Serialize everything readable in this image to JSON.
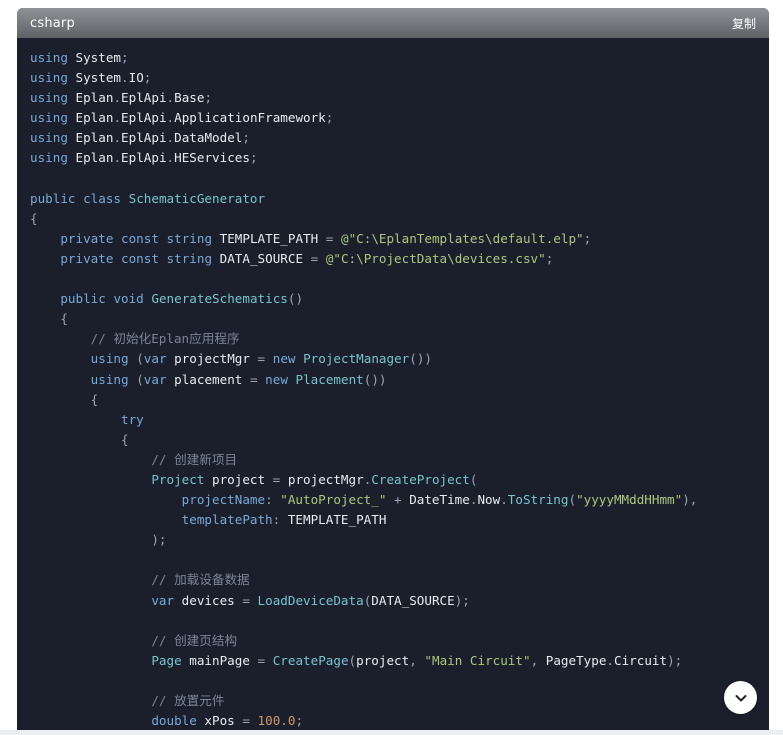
{
  "code_block": {
    "language": "csharp",
    "copy_label": "复制",
    "lines": [
      [
        [
          "kw",
          "using"
        ],
        [
          "ws",
          " "
        ],
        [
          "id",
          "System"
        ],
        [
          "pn",
          ";"
        ]
      ],
      [
        [
          "kw",
          "using"
        ],
        [
          "ws",
          " "
        ],
        [
          "id",
          "System"
        ],
        [
          "pn",
          "."
        ],
        [
          "id",
          "IO"
        ],
        [
          "pn",
          ";"
        ]
      ],
      [
        [
          "kw",
          "using"
        ],
        [
          "ws",
          " "
        ],
        [
          "id",
          "Eplan"
        ],
        [
          "pn",
          "."
        ],
        [
          "id",
          "EplApi"
        ],
        [
          "pn",
          "."
        ],
        [
          "id",
          "Base"
        ],
        [
          "pn",
          ";"
        ]
      ],
      [
        [
          "kw",
          "using"
        ],
        [
          "ws",
          " "
        ],
        [
          "id",
          "Eplan"
        ],
        [
          "pn",
          "."
        ],
        [
          "id",
          "EplApi"
        ],
        [
          "pn",
          "."
        ],
        [
          "id",
          "ApplicationFramework"
        ],
        [
          "pn",
          ";"
        ]
      ],
      [
        [
          "kw",
          "using"
        ],
        [
          "ws",
          " "
        ],
        [
          "id",
          "Eplan"
        ],
        [
          "pn",
          "."
        ],
        [
          "id",
          "EplApi"
        ],
        [
          "pn",
          "."
        ],
        [
          "id",
          "DataModel"
        ],
        [
          "pn",
          ";"
        ]
      ],
      [
        [
          "kw",
          "using"
        ],
        [
          "ws",
          " "
        ],
        [
          "id",
          "Eplan"
        ],
        [
          "pn",
          "."
        ],
        [
          "id",
          "EplApi"
        ],
        [
          "pn",
          "."
        ],
        [
          "id",
          "HEServices"
        ],
        [
          "pn",
          ";"
        ]
      ],
      [],
      [
        [
          "kw",
          "public"
        ],
        [
          "ws",
          " "
        ],
        [
          "kw",
          "class"
        ],
        [
          "ws",
          " "
        ],
        [
          "type",
          "SchematicGenerator"
        ]
      ],
      [
        [
          "pn",
          "{"
        ]
      ],
      [
        [
          "ws",
          "    "
        ],
        [
          "kw",
          "private"
        ],
        [
          "ws",
          " "
        ],
        [
          "kw",
          "const"
        ],
        [
          "ws",
          " "
        ],
        [
          "kw",
          "string"
        ],
        [
          "ws",
          " "
        ],
        [
          "id",
          "TEMPLATE_PATH"
        ],
        [
          "ws",
          " "
        ],
        [
          "pn",
          "="
        ],
        [
          "ws",
          " "
        ],
        [
          "str",
          "@\"C:\\EplanTemplates\\default.elp\""
        ],
        [
          "pn",
          ";"
        ]
      ],
      [
        [
          "ws",
          "    "
        ],
        [
          "kw",
          "private"
        ],
        [
          "ws",
          " "
        ],
        [
          "kw",
          "const"
        ],
        [
          "ws",
          " "
        ],
        [
          "kw",
          "string"
        ],
        [
          "ws",
          " "
        ],
        [
          "id",
          "DATA_SOURCE"
        ],
        [
          "ws",
          " "
        ],
        [
          "pn",
          "="
        ],
        [
          "ws",
          " "
        ],
        [
          "str",
          "@\"C:\\ProjectData\\devices.csv\""
        ],
        [
          "pn",
          ";"
        ]
      ],
      [],
      [
        [
          "ws",
          "    "
        ],
        [
          "kw",
          "public"
        ],
        [
          "ws",
          " "
        ],
        [
          "kw",
          "void"
        ],
        [
          "ws",
          " "
        ],
        [
          "fn",
          "GenerateSchematics"
        ],
        [
          "pn",
          "()"
        ]
      ],
      [
        [
          "ws",
          "    "
        ],
        [
          "pn",
          "{"
        ]
      ],
      [
        [
          "ws",
          "        "
        ],
        [
          "cm",
          "// 初始化Eplan应用程序"
        ]
      ],
      [
        [
          "ws",
          "        "
        ],
        [
          "kw",
          "using"
        ],
        [
          "ws",
          " "
        ],
        [
          "pn",
          "("
        ],
        [
          "kw",
          "var"
        ],
        [
          "ws",
          " "
        ],
        [
          "id",
          "projectMgr"
        ],
        [
          "ws",
          " "
        ],
        [
          "pn",
          "="
        ],
        [
          "ws",
          " "
        ],
        [
          "kw",
          "new"
        ],
        [
          "ws",
          " "
        ],
        [
          "fn",
          "ProjectManager"
        ],
        [
          "pn",
          "())"
        ]
      ],
      [
        [
          "ws",
          "        "
        ],
        [
          "kw",
          "using"
        ],
        [
          "ws",
          " "
        ],
        [
          "pn",
          "("
        ],
        [
          "kw",
          "var"
        ],
        [
          "ws",
          " "
        ],
        [
          "id",
          "placement"
        ],
        [
          "ws",
          " "
        ],
        [
          "pn",
          "="
        ],
        [
          "ws",
          " "
        ],
        [
          "kw",
          "new"
        ],
        [
          "ws",
          " "
        ],
        [
          "fn",
          "Placement"
        ],
        [
          "pn",
          "())"
        ]
      ],
      [
        [
          "ws",
          "        "
        ],
        [
          "pn",
          "{"
        ]
      ],
      [
        [
          "ws",
          "            "
        ],
        [
          "kw",
          "try"
        ]
      ],
      [
        [
          "ws",
          "            "
        ],
        [
          "pn",
          "{"
        ]
      ],
      [
        [
          "ws",
          "                "
        ],
        [
          "cm",
          "// 创建新项目"
        ]
      ],
      [
        [
          "ws",
          "                "
        ],
        [
          "type",
          "Project"
        ],
        [
          "ws",
          " "
        ],
        [
          "id",
          "project"
        ],
        [
          "ws",
          " "
        ],
        [
          "pn",
          "="
        ],
        [
          "ws",
          " "
        ],
        [
          "id",
          "projectMgr"
        ],
        [
          "pn",
          "."
        ],
        [
          "fn",
          "CreateProject"
        ],
        [
          "pn",
          "("
        ]
      ],
      [
        [
          "ws",
          "                    "
        ],
        [
          "param",
          "projectName"
        ],
        [
          "pn",
          ":"
        ],
        [
          "ws",
          " "
        ],
        [
          "str",
          "\"AutoProject_\""
        ],
        [
          "ws",
          " "
        ],
        [
          "pn",
          "+"
        ],
        [
          "ws",
          " "
        ],
        [
          "id",
          "DateTime"
        ],
        [
          "pn",
          "."
        ],
        [
          "id",
          "Now"
        ],
        [
          "pn",
          "."
        ],
        [
          "fn",
          "ToString"
        ],
        [
          "pn",
          "("
        ],
        [
          "str",
          "\"yyyyMMddHHmm\""
        ],
        [
          "pn",
          "),"
        ]
      ],
      [
        [
          "ws",
          "                    "
        ],
        [
          "param",
          "templatePath"
        ],
        [
          "pn",
          ":"
        ],
        [
          "ws",
          " "
        ],
        [
          "id",
          "TEMPLATE_PATH"
        ]
      ],
      [
        [
          "ws",
          "                "
        ],
        [
          "pn",
          ");"
        ]
      ],
      [],
      [
        [
          "ws",
          "                "
        ],
        [
          "cm",
          "// 加载设备数据"
        ]
      ],
      [
        [
          "ws",
          "                "
        ],
        [
          "kw",
          "var"
        ],
        [
          "ws",
          " "
        ],
        [
          "id",
          "devices"
        ],
        [
          "ws",
          " "
        ],
        [
          "pn",
          "="
        ],
        [
          "ws",
          " "
        ],
        [
          "fn",
          "LoadDeviceData"
        ],
        [
          "pn",
          "("
        ],
        [
          "id",
          "DATA_SOURCE"
        ],
        [
          "pn",
          ");"
        ]
      ],
      [],
      [
        [
          "ws",
          "                "
        ],
        [
          "cm",
          "// 创建页结构"
        ]
      ],
      [
        [
          "ws",
          "                "
        ],
        [
          "type",
          "Page"
        ],
        [
          "ws",
          " "
        ],
        [
          "id",
          "mainPage"
        ],
        [
          "ws",
          " "
        ],
        [
          "pn",
          "="
        ],
        [
          "ws",
          " "
        ],
        [
          "fn",
          "CreatePage"
        ],
        [
          "pn",
          "("
        ],
        [
          "id",
          "project"
        ],
        [
          "pn",
          ","
        ],
        [
          "ws",
          " "
        ],
        [
          "str",
          "\"Main Circuit\""
        ],
        [
          "pn",
          ","
        ],
        [
          "ws",
          " "
        ],
        [
          "id",
          "PageType"
        ],
        [
          "pn",
          "."
        ],
        [
          "id",
          "Circuit"
        ],
        [
          "pn",
          ");"
        ]
      ],
      [],
      [
        [
          "ws",
          "                "
        ],
        [
          "cm",
          "// 放置元件"
        ]
      ],
      [
        [
          "ws",
          "                "
        ],
        [
          "kw",
          "double"
        ],
        [
          "ws",
          " "
        ],
        [
          "id",
          "xPos"
        ],
        [
          "ws",
          " "
        ],
        [
          "pn",
          "="
        ],
        [
          "ws",
          " "
        ],
        [
          "num",
          "100.0"
        ],
        [
          "pn",
          ";"
        ]
      ]
    ]
  },
  "icons": {
    "scroll_down": "chevron-down-icon"
  },
  "colors": {
    "code_background": "#1a1f2b",
    "header_background": "#75787c",
    "keyword": "#78a9d8",
    "identifier": "#e8ecf2",
    "type": "#78c4cf",
    "string": "#a8c97f",
    "number": "#d19a66",
    "comment": "#7a8596"
  }
}
